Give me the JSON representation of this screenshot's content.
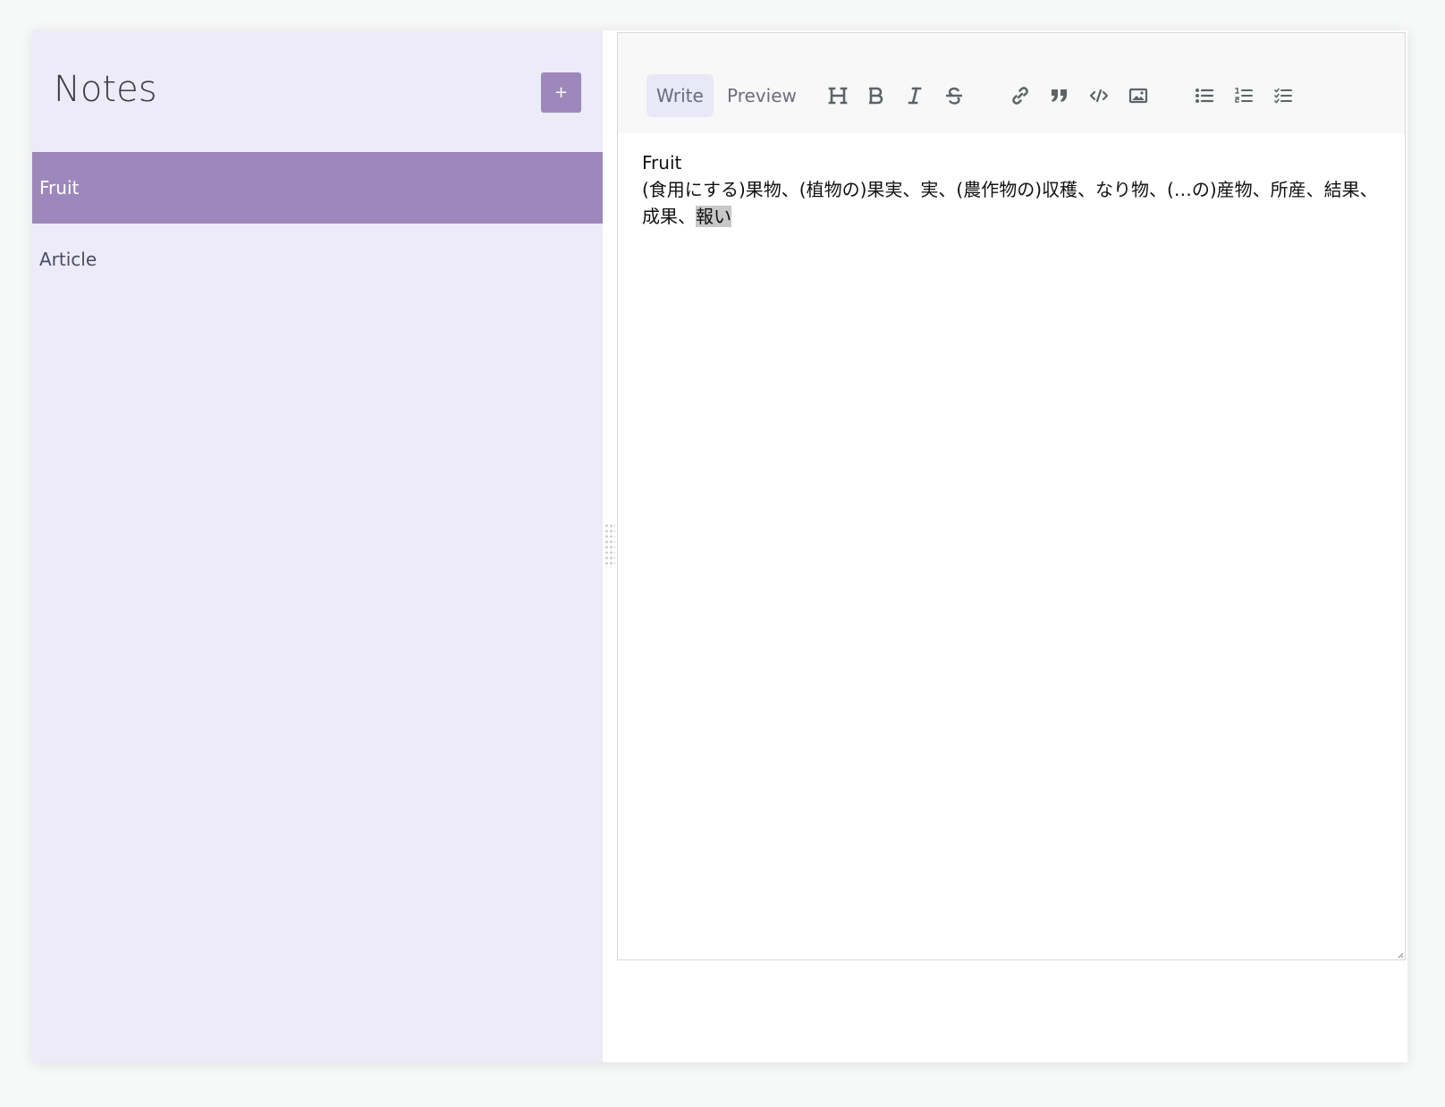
{
  "sidebar": {
    "title": "Notes",
    "add_button_label": "+",
    "notes": [
      {
        "title": "Fruit",
        "selected": true
      },
      {
        "title": "Article",
        "selected": false
      }
    ]
  },
  "editor": {
    "tabs": {
      "write": "Write",
      "preview": "Preview"
    },
    "active_tab": "Write",
    "toolbar_icons": [
      "heading-icon",
      "bold-icon",
      "italic-icon",
      "strikethrough-icon",
      "link-icon",
      "quote-icon",
      "code-icon",
      "image-icon",
      "unordered-list-icon",
      "ordered-list-icon",
      "checked-list-icon"
    ],
    "content_line1": "Fruit",
    "content_line2": "(食用にする)果物、(植物の)果実、実、(農作物の)収穫、なり物、(…の)産物、所産、結果、成果、",
    "content_selection": "報い"
  },
  "colors": {
    "accent": "#9d88bb",
    "sidebar_background": "#ecebf7",
    "toolbar_background": "#f8f8f8",
    "selection_highlight": "#c8c8c8"
  }
}
